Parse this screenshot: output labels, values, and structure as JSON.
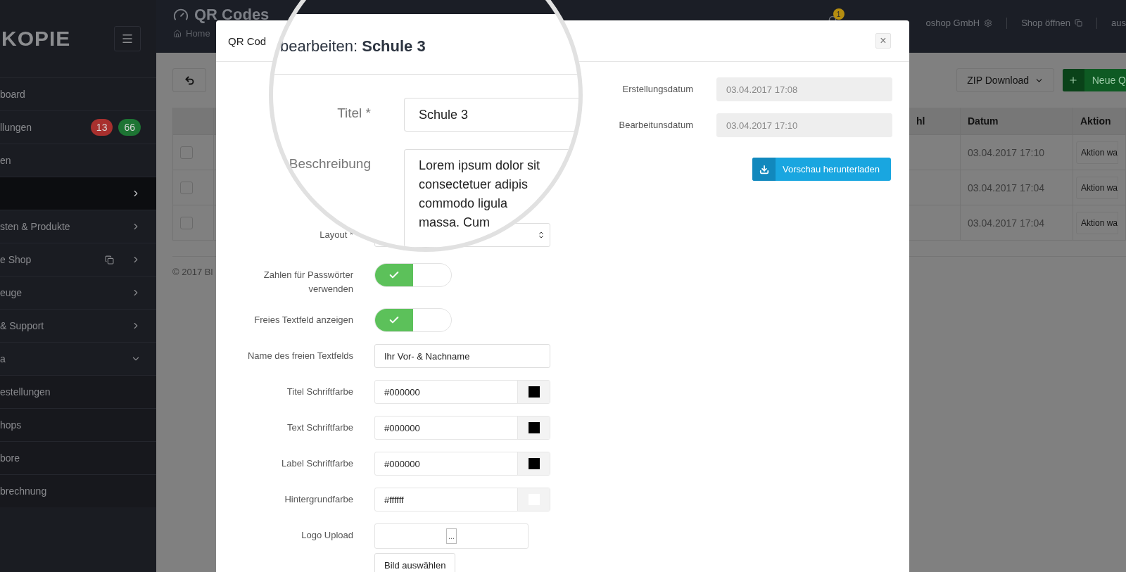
{
  "sidebar": {
    "logo": "KOPIE",
    "items": [
      {
        "kind": "link",
        "label": "board",
        "selected": false
      },
      {
        "kind": "link",
        "label": "llungen",
        "selected": false,
        "badges": [
          {
            "text": "13",
            "color": "#a8302e"
          },
          {
            "text": "66",
            "color": "#1d7433"
          }
        ]
      },
      {
        "kind": "link",
        "label": "en",
        "selected": false
      },
      {
        "kind": "submenu",
        "selected": true
      },
      {
        "kind": "submenu",
        "label": "sten & Produkte",
        "selected": false
      },
      {
        "kind": "external",
        "label": "e Shop",
        "selected": false
      },
      {
        "kind": "submenu",
        "label": "euge",
        "selected": false
      },
      {
        "kind": "submenu",
        "label": "& Support",
        "selected": false
      },
      {
        "kind": "expanded",
        "label": "a",
        "selected": false
      },
      {
        "kind": "subitem",
        "label": "estellungen",
        "selected": false
      },
      {
        "kind": "subitem",
        "label": "hops",
        "selected": false
      },
      {
        "kind": "subitem",
        "label": "bore",
        "selected": false
      },
      {
        "kind": "subitem",
        "label": "brechnung",
        "selected": false
      }
    ]
  },
  "header": {
    "title": "QR Codes",
    "breadcrumb": "Home",
    "notifications": "1",
    "account": "oshop GmbH",
    "shop_link": "Shop öffnen",
    "logout": "aus"
  },
  "content": {
    "zip_button": "ZIP Download",
    "new_button": "Neue Q",
    "table": {
      "columns": [
        {
          "label": "hl"
        },
        {
          "label": "Datum"
        },
        {
          "label": "Aktion"
        }
      ],
      "rows": [
        {
          "checked": false,
          "date": "03.04.2017 17:10",
          "action": "Aktion wa"
        },
        {
          "checked": false,
          "date": "03.04.2017 17:04",
          "action": "Aktion wa"
        },
        {
          "checked": false,
          "date": "03.04.2017 17:04",
          "action": "Aktion wa"
        }
      ]
    },
    "footer": "© 2017 Bl"
  },
  "modal": {
    "title": "QR Cod",
    "close": "×",
    "magnifier": {
      "title": "bearbeiten: **Schule 3**",
      "title_label": "Titel *",
      "title_value": "Schule 3",
      "description_label": "Beschreibung",
      "description_lines": [
        "Lorem ipsum dolor sit",
        "consectetuer adipis",
        "commodo ligula",
        "massa. Cum"
      ]
    },
    "form": [
      {
        "kind": "select",
        "label": "Layout *"
      },
      {
        "kind": "toggle",
        "label": "Zahlen für Passwörter verwenden",
        "checked": true
      },
      {
        "kind": "toggle",
        "label": "Freies Textfeld anzeigen",
        "checked": true
      },
      {
        "kind": "text",
        "label": "Name des freien Textfelds",
        "value": "Ihr Vor- & Nachname"
      },
      {
        "kind": "color",
        "label": "Titel Schriftfarbe",
        "value": "#000000",
        "color": "#000000"
      },
      {
        "kind": "color",
        "label": "Text Schriftfarbe",
        "value": "#000000",
        "color": "#000000"
      },
      {
        "kind": "color",
        "label": "Label Schriftfarbe",
        "value": "#000000",
        "color": "#000000"
      },
      {
        "kind": "color",
        "label": "Hintergrundfarbe",
        "value": "#ffffff",
        "color": "#ffffff"
      },
      {
        "kind": "file",
        "label": "Logo Upload",
        "browse": "...",
        "button": "Bild auswählen"
      }
    ],
    "dates": [
      {
        "label": "Erstellungsdatum",
        "value": "03.04.2017 17:08"
      },
      {
        "label": "Bearbeitunsdatum",
        "value": "03.04.2017 17:10"
      }
    ],
    "download_button": "Vorschau herunterladen"
  }
}
